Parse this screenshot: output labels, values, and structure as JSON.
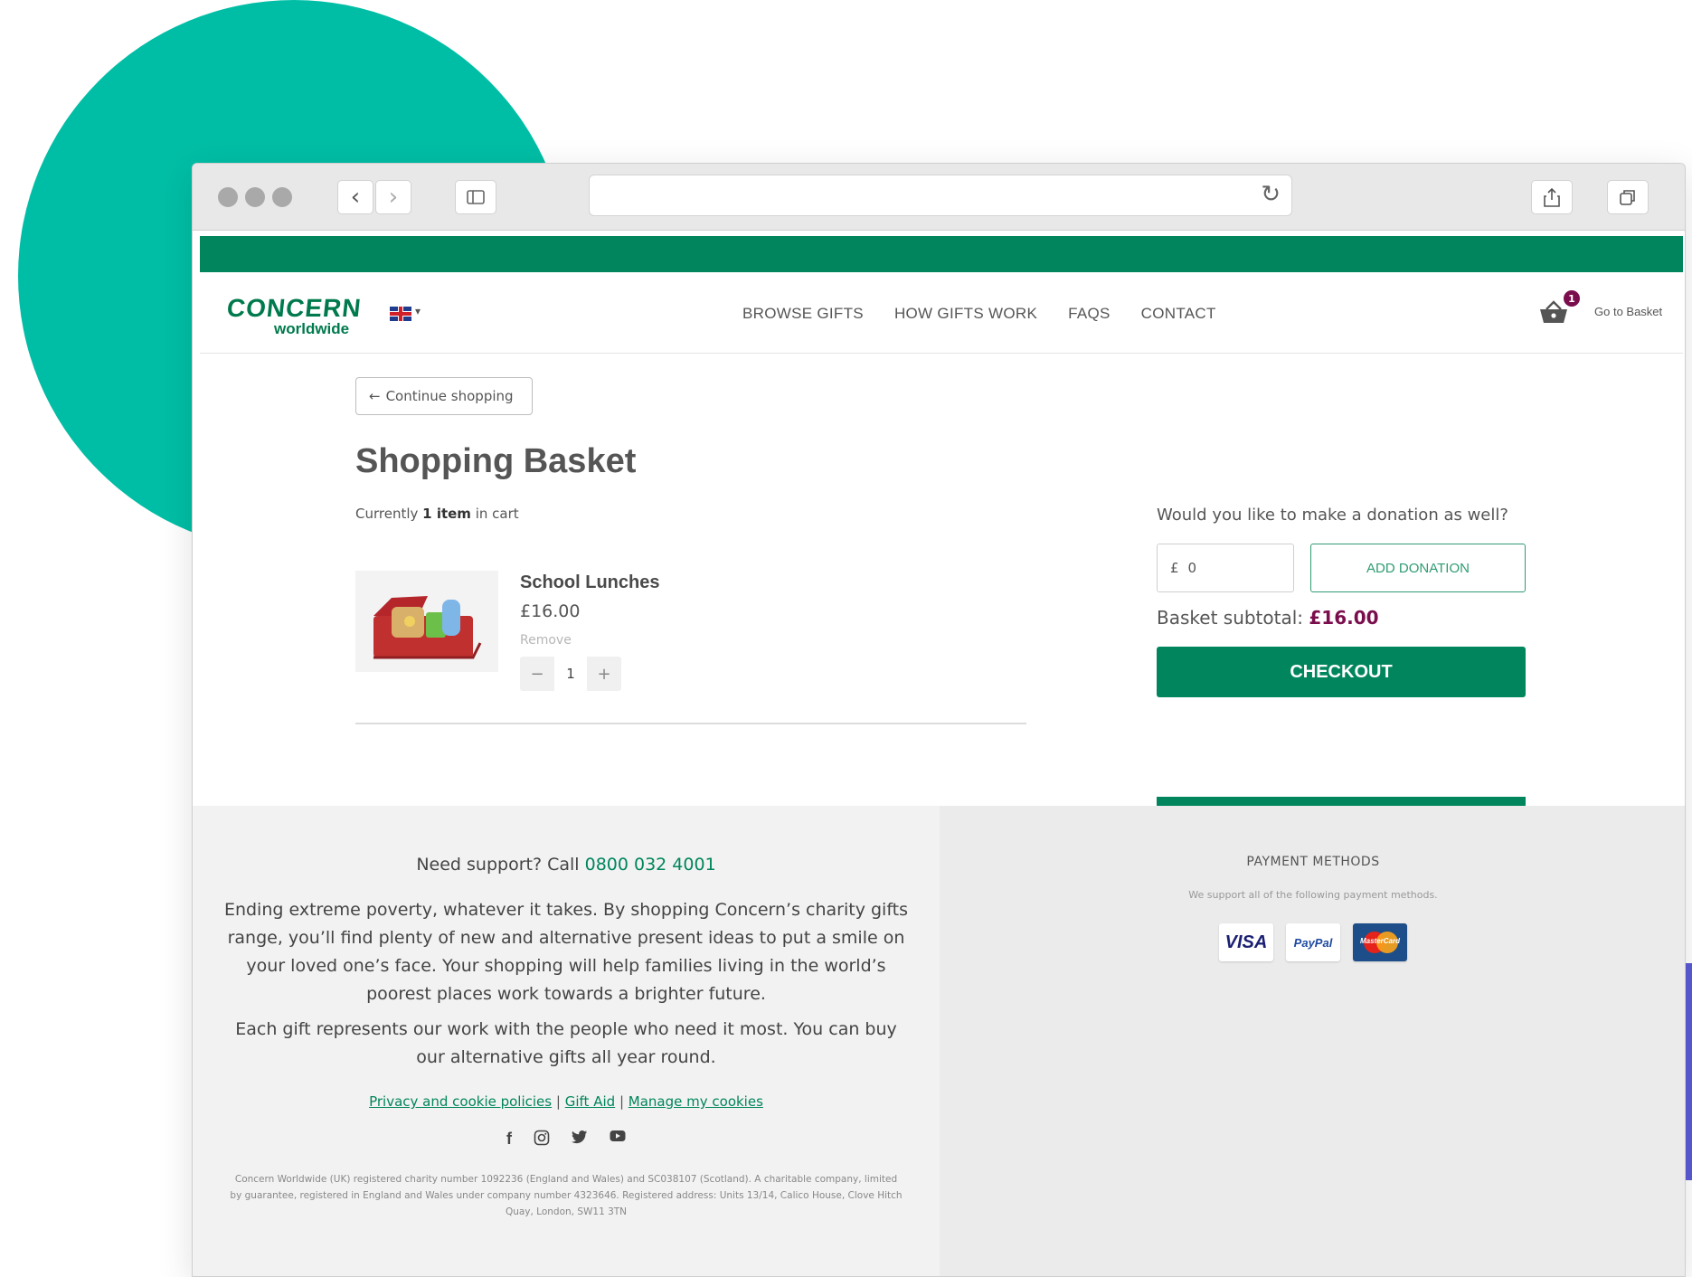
{
  "brand": {
    "logo_line1": "CONCERN",
    "logo_line2": "worldwide",
    "colors": {
      "green": "#00855c",
      "teal": "#00bea5",
      "plum": "#7a0e4d"
    }
  },
  "nav": {
    "items": [
      "BROWSE GIFTS",
      "HOW GIFTS WORK",
      "FAQS",
      "CONTACT"
    ],
    "basket_count": "1",
    "basket_label": "Go to Basket",
    "language_icon": "uk-flag-icon"
  },
  "basket": {
    "continue_label": "Continue shopping",
    "title": "Shopping Basket",
    "count_prefix": "Currently ",
    "count_bold": "1 item",
    "count_suffix": " in cart",
    "items": [
      {
        "name": "School Lunches",
        "price": "£16.00",
        "remove_label": "Remove",
        "quantity": "1"
      }
    ]
  },
  "donation": {
    "question": "Would you like to make a donation as well?",
    "currency": "£",
    "amount_value": "0",
    "add_label": "ADD DONATION",
    "subtotal_label": "Basket subtotal: ",
    "subtotal_value": "£16.00",
    "checkout_label": "CHECKOUT"
  },
  "footer": {
    "support_prefix": "Need support? Call ",
    "support_phone": "0800 032 4001",
    "about_1": "Ending extreme poverty, whatever it takes. By shopping Concern’s charity gifts range, you’ll find plenty of new and alternative present ideas to put a smile on your loved one’s face. Your shopping will help families living in the world’s poorest places work towards a brighter future.",
    "about_2": "Each gift represents our work with the people who need it most. You can buy our alternative gifts all year round.",
    "links": [
      "Privacy and cookie policies",
      "Gift Aid",
      "Manage my cookies"
    ],
    "link_separator": "|",
    "social": [
      "f",
      "◎",
      "🐦",
      "▶"
    ],
    "legal": "Concern Worldwide (UK) registered charity number 1092236 (England and Wales) and SC038107 (Scotland). A charitable company, limited by guarantee, registered in England and Wales under company number 4323646. Registered address: Units 13/14, Calico House, Clove Hitch Quay, London, SW11 3TN",
    "payment_title": "PAYMENT METHODS",
    "payment_sub": "We support all of the following payment methods.",
    "payment_cards": [
      "VISA",
      "PayPal",
      "MasterCard"
    ]
  }
}
